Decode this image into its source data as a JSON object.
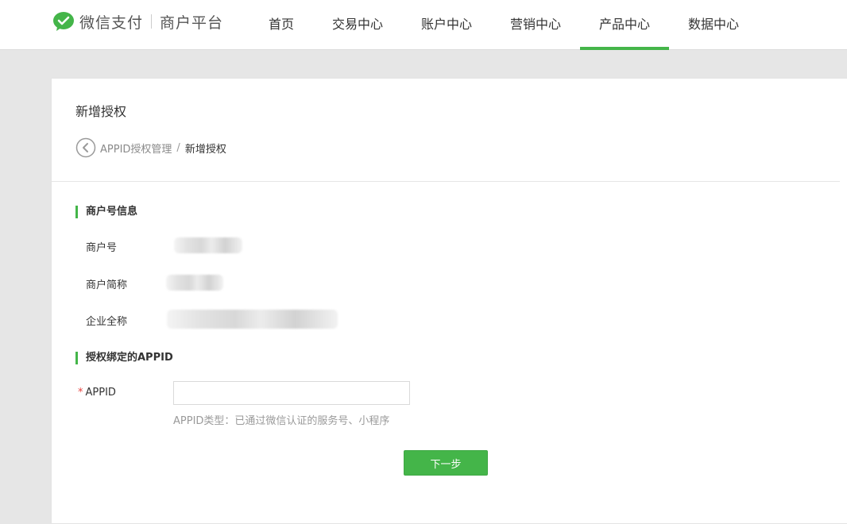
{
  "brand": {
    "name": "微信支付",
    "sub": "商户平台",
    "colors": {
      "accent": "#44b549",
      "required": "#e64340"
    }
  },
  "nav": {
    "items": [
      {
        "label": "首页"
      },
      {
        "label": "交易中心"
      },
      {
        "label": "账户中心"
      },
      {
        "label": "营销中心"
      },
      {
        "label": "产品中心",
        "active": true
      },
      {
        "label": "数据中心"
      }
    ]
  },
  "page": {
    "title": "新增授权",
    "breadcrumb": {
      "parent": "APPID授权管理",
      "separator": "/",
      "current": "新增授权"
    }
  },
  "merchant_info": {
    "section_title": "商户号信息",
    "fields": [
      {
        "label": "商户号",
        "value_hidden": true
      },
      {
        "label": "商户简称",
        "value_hidden": true
      },
      {
        "label": "企业全称",
        "value_hidden": true
      }
    ]
  },
  "appid_section": {
    "section_title": "授权绑定的APPID",
    "required_mark": "*",
    "label": "APPID",
    "input_value": "",
    "hint": "APPID类型：已通过微信认证的服务号、小程序"
  },
  "actions": {
    "next": "下一步"
  }
}
